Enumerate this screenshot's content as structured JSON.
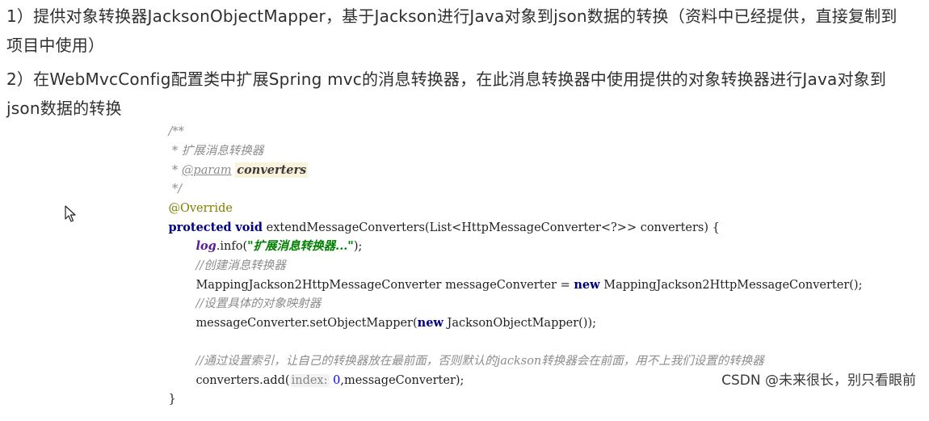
{
  "paragraphs": {
    "p1_line1": "1）提供对象转换器JacksonObjectMapper，基于Jackson进行Java对象到json数据的转换（资料中已经提供，直接复制到",
    "p1_line2": "项目中使用）",
    "p2_line1": "2）在WebMvcConfig配置类中扩展Spring mvc的消息转换器，在此消息转换器中使用提供的对象转换器进行Java对象到",
    "p2_line2": "json数据的转换"
  },
  "code": {
    "doc_open": "/**",
    "doc_line1": " * 扩展消息转换器",
    "doc_star": " * ",
    "doc_tag": "@param",
    "doc_param": "converters",
    "doc_close": " */",
    "annotation": "@Override",
    "kw_protected": "protected",
    "kw_void": "void",
    "method_sig": " extendMessageConverters(List<HttpMessageConverter<?>> converters) {",
    "log_field": "log",
    "log_call_pre": ".info(",
    "log_string": "\"扩展消息转换器...\"",
    "log_call_post": ");",
    "comment_create": "//创建消息转换器",
    "decl_pre": "MappingJackson2HttpMessageConverter messageConverter = ",
    "kw_new1": "new",
    "decl_post": " MappingJackson2HttpMessageConverter();",
    "comment_set": "//设置具体的对象映射器",
    "set_pre": "messageConverter.setObjectMapper(",
    "kw_new2": "new",
    "set_post": " JacksonObjectMapper());",
    "comment_index": "//通过设置索引，让自己的转换器放在最前面，否则默认的jackson转换器会在前面，用不上我们设置的转换器",
    "add_pre": "converters.add(",
    "add_hint": "index:",
    "add_num": "0",
    "add_post": ",messageConverter);",
    "close_brace": "}"
  },
  "watermark": "CSDN @未来很长，别只看眼前",
  "icons": {
    "cursor": "mouse-pointer-icon"
  }
}
